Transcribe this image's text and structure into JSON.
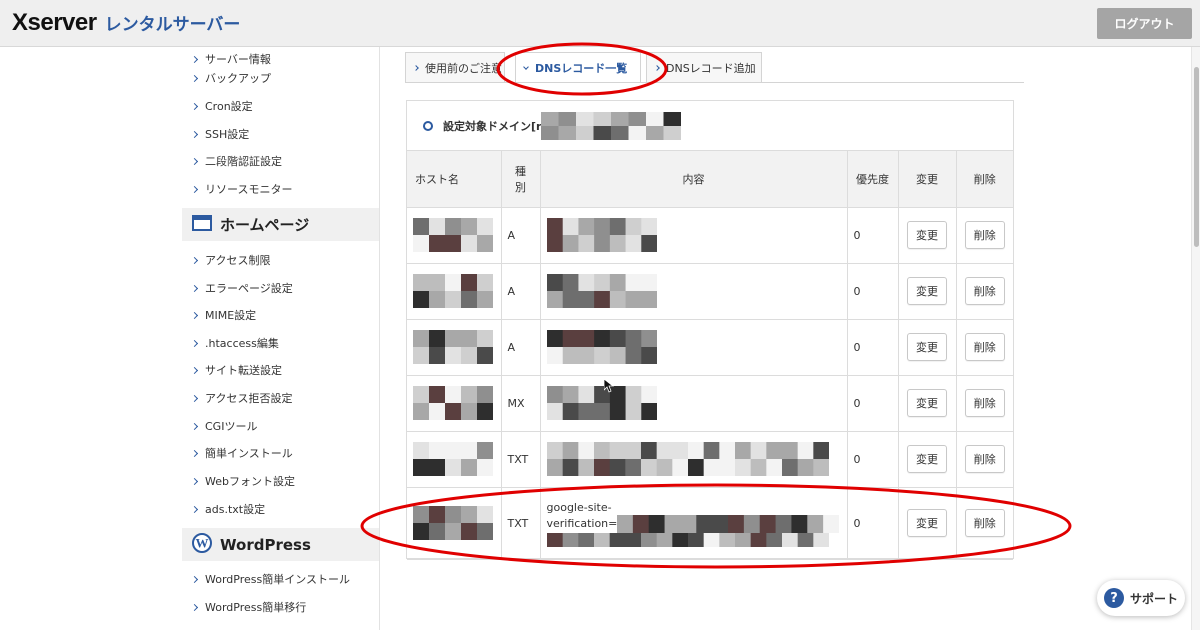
{
  "header": {
    "logo_main": "Xserver",
    "logo_sub": "レンタルサーバー",
    "logout_label": "ログアウト"
  },
  "sidebar": {
    "group1": [
      {
        "label": "サーバー情報"
      },
      {
        "label": "バックアップ"
      },
      {
        "label": "Cron設定"
      },
      {
        "label": "SSH設定"
      },
      {
        "label": "二段階認証設定"
      },
      {
        "label": "リソースモニター"
      }
    ],
    "homepage_section": {
      "title": "ホームページ",
      "icon": "browser-window-icon"
    },
    "group2": [
      {
        "label": "アクセス制限"
      },
      {
        "label": "エラーページ設定"
      },
      {
        "label": "MIME設定"
      },
      {
        "label": ".htaccess編集"
      },
      {
        "label": "サイト転送設定"
      },
      {
        "label": "アクセス拒否設定"
      },
      {
        "label": "CGIツール"
      },
      {
        "label": "簡単インストール"
      },
      {
        "label": "Webフォント設定"
      },
      {
        "label": "ads.txt設定"
      }
    ],
    "wordpress_section": {
      "title": "WordPress",
      "icon": "wordpress-icon"
    },
    "group3": [
      {
        "label": "WordPress簡単インストール"
      },
      {
        "label": "WordPress簡単移行"
      }
    ]
  },
  "tabs": [
    {
      "label": "使用前のご注意",
      "active": false
    },
    {
      "label": "DNSレコード一覧",
      "active": true
    },
    {
      "label": "DNSレコード追加",
      "active": false
    }
  ],
  "domain": {
    "label": "設定対象ドメイン[r"
  },
  "table": {
    "headers": {
      "host": "ホスト名",
      "type_top": "種",
      "type_bottom": "別",
      "content": "内容",
      "priority": "優先度",
      "edit": "変更",
      "delete": "削除"
    },
    "rows": [
      {
        "type": "A",
        "content_text": "",
        "priority": "0",
        "edit": "変更",
        "delete": "削除"
      },
      {
        "type": "A",
        "content_text": "",
        "priority": "0",
        "edit": "変更",
        "delete": "削除"
      },
      {
        "type": "A",
        "content_text": "",
        "priority": "0",
        "edit": "変更",
        "delete": "削除"
      },
      {
        "type": "MX",
        "content_text": "",
        "priority": "0",
        "edit": "変更",
        "delete": "削除"
      },
      {
        "type": "TXT",
        "content_text": "",
        "priority": "0",
        "edit": "変更",
        "delete": "削除"
      },
      {
        "type": "TXT",
        "content_text_line1": "google-site-",
        "content_text_line2": "verification=",
        "priority": "0",
        "edit": "変更",
        "delete": "削除"
      }
    ]
  },
  "support": {
    "label": "サポート",
    "icon": "question-icon"
  },
  "colors": {
    "accent": "#2c5aa0",
    "annotation": "#e00000",
    "logout_bg": "#a5a5a5"
  }
}
